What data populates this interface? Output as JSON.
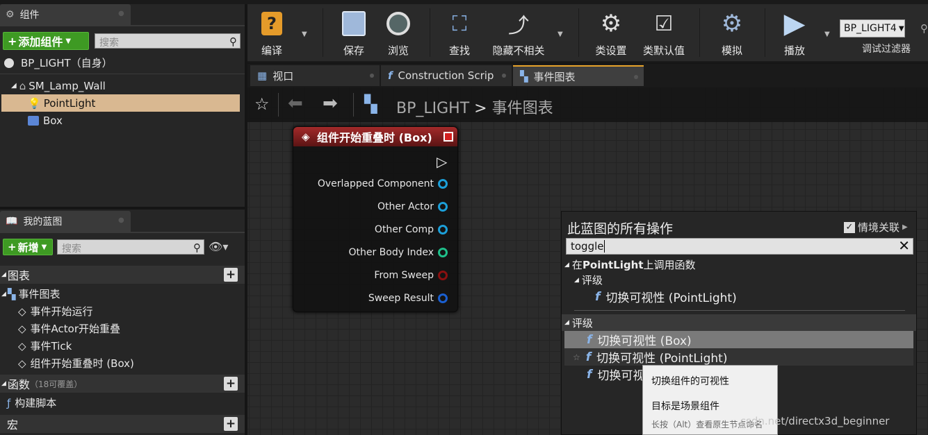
{
  "left_panel": {
    "components_tab": "组件",
    "add_component": "添加组件",
    "search_placeholder": "搜索",
    "root": "BP_LIGHT（自身）",
    "tree": [
      "SM_Lamp_Wall",
      "PointLight",
      "Box"
    ],
    "my_blueprint_tab": "我的蓝图",
    "new_btn": "新增",
    "search2_placeholder": "搜索",
    "graphs_label": "图表",
    "event_graph": "事件图表",
    "events": [
      "事件开始运行",
      "事件Actor开始重叠",
      "事件Tick",
      "组件开始重叠时 (Box)"
    ],
    "functions_label": "函数",
    "functions_count": "（18可覆盖）",
    "construction_script": "构建脚本",
    "macros_label": "宏"
  },
  "toolbar": {
    "compile": "编译",
    "save": "保存",
    "browse": "浏览",
    "find": "查找",
    "hide_unrelated": "隐藏不相关",
    "class_settings": "类设置",
    "class_defaults": "类默认值",
    "simulate": "模拟",
    "play": "播放",
    "debug_object": "BP_LIGHT4",
    "debug_filter": "调试过滤器"
  },
  "tabs": [
    "视口",
    "Construction Scrip",
    "事件图表"
  ],
  "breadcrumb": {
    "blueprint": "BP_LIGHT",
    "sep": ">",
    "graph": "事件图表"
  },
  "node": {
    "title": "组件开始重叠时 (Box)",
    "pins": [
      {
        "label": "Overlapped Component",
        "color": "#1c9fd8"
      },
      {
        "label": "Other Actor",
        "color": "#1c9fd8"
      },
      {
        "label": "Other Comp",
        "color": "#1c9fd8"
      },
      {
        "label": "Other Body Index",
        "color": "#1fbf8a"
      },
      {
        "label": "From Sweep",
        "color": "#8a1010"
      },
      {
        "label": "Sweep Result",
        "color": "#1a5fd0"
      }
    ]
  },
  "action_menu": {
    "title": "此蓝图的所有操作",
    "context_label": "情境关联",
    "query": "toggle",
    "cat1_prefix": "在 ",
    "cat1_bold": "PointLight",
    "cat1_suffix": "上调用函数",
    "rating": "评级",
    "item_pl1": "切换可视性 (PointLight)",
    "rating2": "评级",
    "item_box": "切换可视性 (Box)",
    "item_pl2": "切换可视性 (PointLight)",
    "item_partial": "切换可视"
  },
  "tooltip": {
    "line1": "切换组件的可视性",
    "line2": "目标是场景组件",
    "line3": "长按（Alt）查看原生节点命名"
  },
  "watermark": ".csdn.net/directx3d_beginner"
}
